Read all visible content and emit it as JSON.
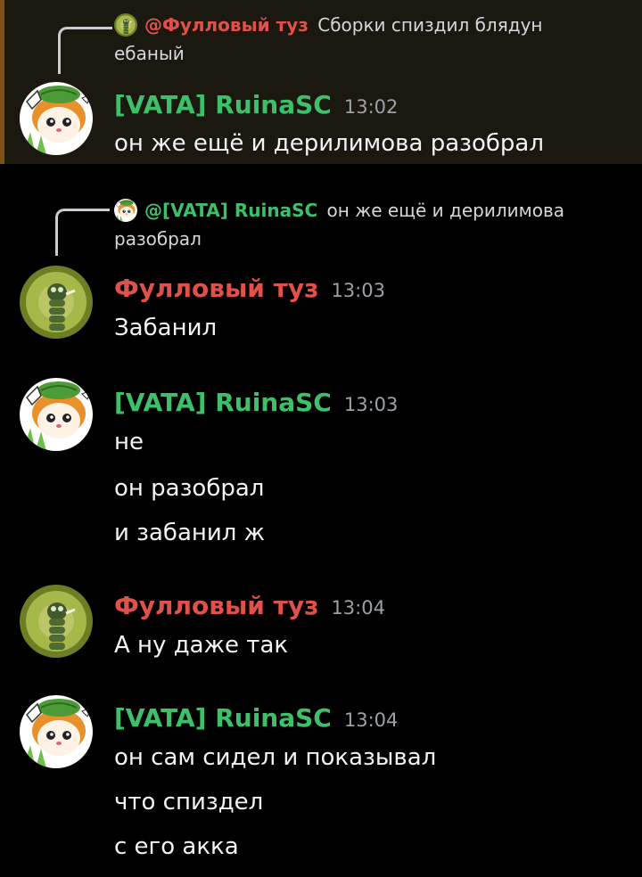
{
  "colors": {
    "ruina": "#3ec06b",
    "tuz": "#e0514a",
    "time": "#9da1a8",
    "highlight_bg": "#1b1810",
    "highlight_bar": "#7a5318"
  },
  "messages": [
    {
      "reply_author": "@Фулловый туз",
      "reply_text_1": "Сборки спиздил блядун",
      "reply_text_2": "ебаный",
      "author": "[VATA] RuinaSC",
      "time": "13:02",
      "lines": [
        "он же ещё и дерилимова разобрал"
      ]
    },
    {
      "reply_author": "@[VATA] RuinaSC",
      "reply_text_1": "он же ещё и дерилимова",
      "reply_text_2": "разобрал",
      "author": "Фулловый туз",
      "time": "13:03",
      "lines": [
        "Забанил"
      ]
    },
    {
      "author": "[VATA] RuinaSC",
      "time": "13:03",
      "lines": [
        "не",
        "он разобрал",
        "и забанил ж"
      ]
    },
    {
      "author": "Фулловый туз",
      "time": "13:04",
      "lines": [
        "А ну даже так"
      ]
    },
    {
      "author": "[VATA] RuinaSC",
      "time": "13:04",
      "lines": [
        "он сам сидел и показывал",
        "что спиздел",
        "с его акка"
      ]
    }
  ]
}
